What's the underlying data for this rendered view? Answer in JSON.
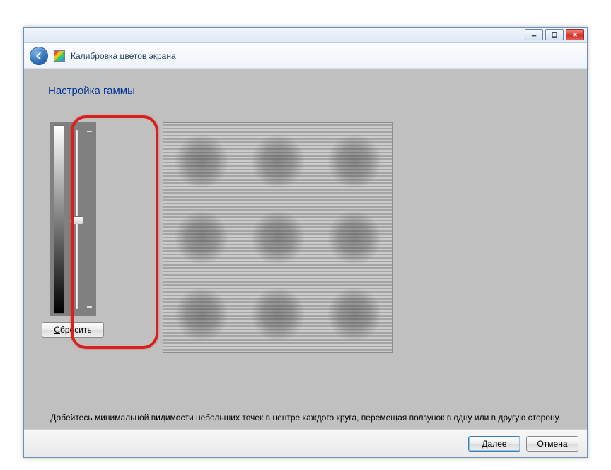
{
  "window": {
    "title": "Калибровка цветов экрана"
  },
  "heading": "Настройка гаммы",
  "slider": {
    "reset_prefix": "С",
    "reset_rest": "бросить"
  },
  "instruction": "Добейтесь минимальной видимости небольших точек в центре каждого круга, перемещая ползунок в одну или в другую сторону.",
  "footer": {
    "next_prefix": "Д",
    "next_rest": "алее",
    "cancel": "Отмена"
  }
}
